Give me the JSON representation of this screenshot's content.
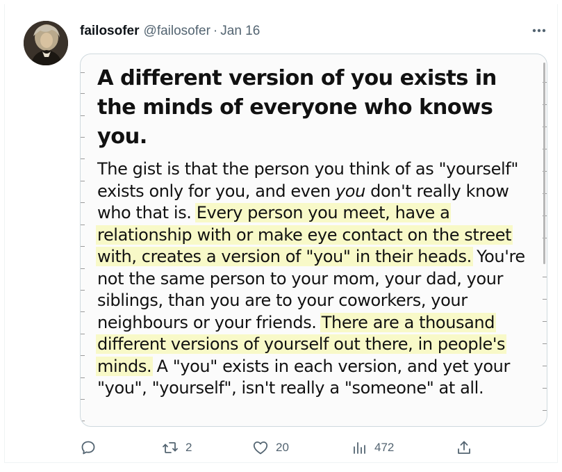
{
  "author": {
    "name": "failosofer",
    "handle": "@failosofer",
    "separator": "·",
    "date": "Jan 16"
  },
  "media": {
    "headline": "A different version of you exists in the minds of everyone who knows you.",
    "paragraph": {
      "p1": "The gist is that the person you think of as \"yourself\" exists only for you, and even ",
      "p1_italic": "you",
      "p2": " don't really know who that is. ",
      "highlight1": "Every person you meet, have a relationship with or make eye contact on the street with, creates a version of \"you\" in their heads.",
      "p3": " You're not the same person to your mom, your dad, your siblings, than you are to your coworkers, your neighbours or your friends. ",
      "highlight2": "There are a thousand different versions of yourself out there, in people's minds.",
      "p4": " A \"you\" exists in each version, and yet your \"you\", \"yourself\", isn't really a \"someone\" at all."
    },
    "highlight_color": "#f8f9c8"
  },
  "actions": {
    "reply": {
      "icon": "reply-icon",
      "count": ""
    },
    "retweet": {
      "icon": "retweet-icon",
      "count": "2"
    },
    "like": {
      "icon": "heart-icon",
      "count": "20"
    },
    "views": {
      "icon": "analytics-icon",
      "count": "472"
    },
    "share": {
      "icon": "share-icon",
      "count": ""
    }
  },
  "colors": {
    "text_primary": "#0f1419",
    "text_secondary": "#536471",
    "border": "#cfd9de"
  }
}
